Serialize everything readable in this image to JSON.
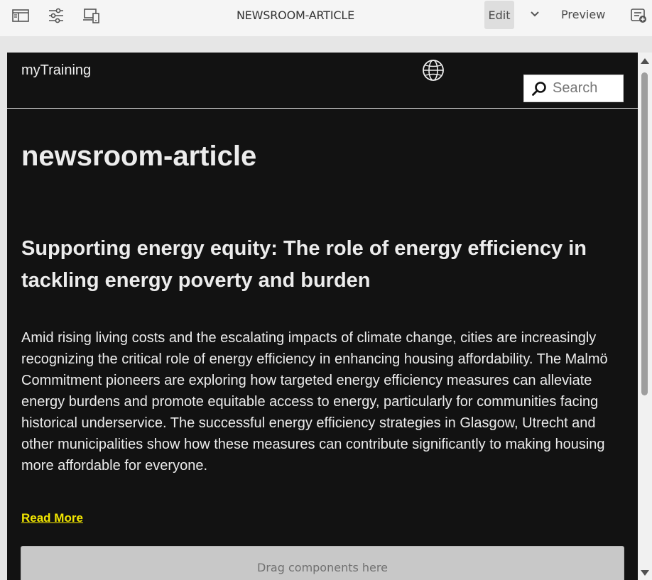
{
  "toolbar": {
    "title": "NEWSROOM-ARTICLE",
    "edit_label": "Edit",
    "preview_label": "Preview",
    "icons": [
      "side-panel-icon",
      "page-properties-icon",
      "emulator-icon",
      "chevron-down-icon",
      "annotations-icon"
    ]
  },
  "site": {
    "brand": "myTraining",
    "search_placeholder": "Search"
  },
  "article": {
    "page_title": "newsroom-article",
    "headline": "Supporting energy equity: The role of energy efficiency in tackling energy poverty and burden",
    "body": "Amid rising living costs and the escalating impacts of climate change, cities are increasingly recognizing the critical role of energy efficiency in enhancing housing affordability. The Malmö Commitment pioneers are exploring how targeted energy efficiency measures can alleviate energy burdens and promote equitable access to energy, particularly for communities facing historical underservice. The successful energy efficiency strategies in Glasgow, Utrecht and other municipalities show how these measures can contribute significantly to making housing more affordable for everyone.",
    "read_more": "Read More"
  },
  "editor": {
    "dropzone_label": "Drag components here"
  },
  "colors": {
    "page_bg": "#121212",
    "link": "#f2e600",
    "toolbar_bg": "#f5f5f5"
  }
}
